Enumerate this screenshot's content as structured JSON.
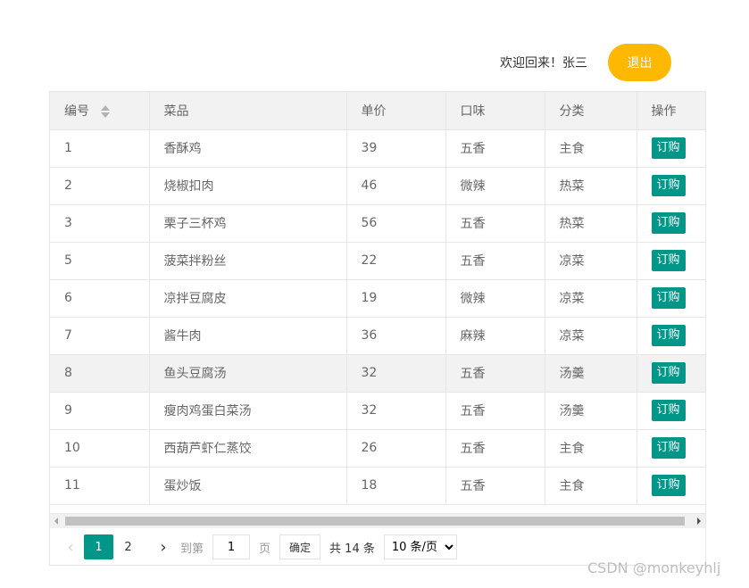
{
  "header": {
    "welcome_text": "欢迎回来！张三",
    "logout_label": "退出"
  },
  "table": {
    "columns": [
      "编号",
      "菜品",
      "单价",
      "口味",
      "分类",
      "操作"
    ],
    "order_label": "订购",
    "rows": [
      {
        "id": "1",
        "name": "香酥鸡",
        "price": "39",
        "taste": "五香",
        "category": "主食"
      },
      {
        "id": "2",
        "name": "烧椒扣肉",
        "price": "46",
        "taste": "微辣",
        "category": "热菜"
      },
      {
        "id": "3",
        "name": "栗子三杯鸡",
        "price": "56",
        "taste": "五香",
        "category": "热菜"
      },
      {
        "id": "5",
        "name": "菠菜拌粉丝",
        "price": "22",
        "taste": "五香",
        "category": "凉菜"
      },
      {
        "id": "6",
        "name": "凉拌豆腐皮",
        "price": "19",
        "taste": "微辣",
        "category": "凉菜"
      },
      {
        "id": "7",
        "name": "酱牛肉",
        "price": "36",
        "taste": "麻辣",
        "category": "凉菜"
      },
      {
        "id": "8",
        "name": "鱼头豆腐汤",
        "price": "32",
        "taste": "五香",
        "category": "汤羹"
      },
      {
        "id": "9",
        "name": "瘦肉鸡蛋白菜汤",
        "price": "32",
        "taste": "五香",
        "category": "汤羹"
      },
      {
        "id": "10",
        "name": "西葫芦虾仁蒸饺",
        "price": "26",
        "taste": "五香",
        "category": "主食"
      },
      {
        "id": "11",
        "name": "蛋炒饭",
        "price": "18",
        "taste": "五香",
        "category": "主食"
      }
    ]
  },
  "pager": {
    "pages": [
      "1",
      "2"
    ],
    "current_page": "1",
    "goto_label": "到第",
    "goto_value": "1",
    "page_suffix": "页",
    "confirm_label": "确定",
    "total_text": "共 14 条",
    "page_size_selected": "10 条/页"
  },
  "watermark": "CSDN @monkeyhlj",
  "colors": {
    "accent": "#009688",
    "logout": "#ffb800"
  }
}
